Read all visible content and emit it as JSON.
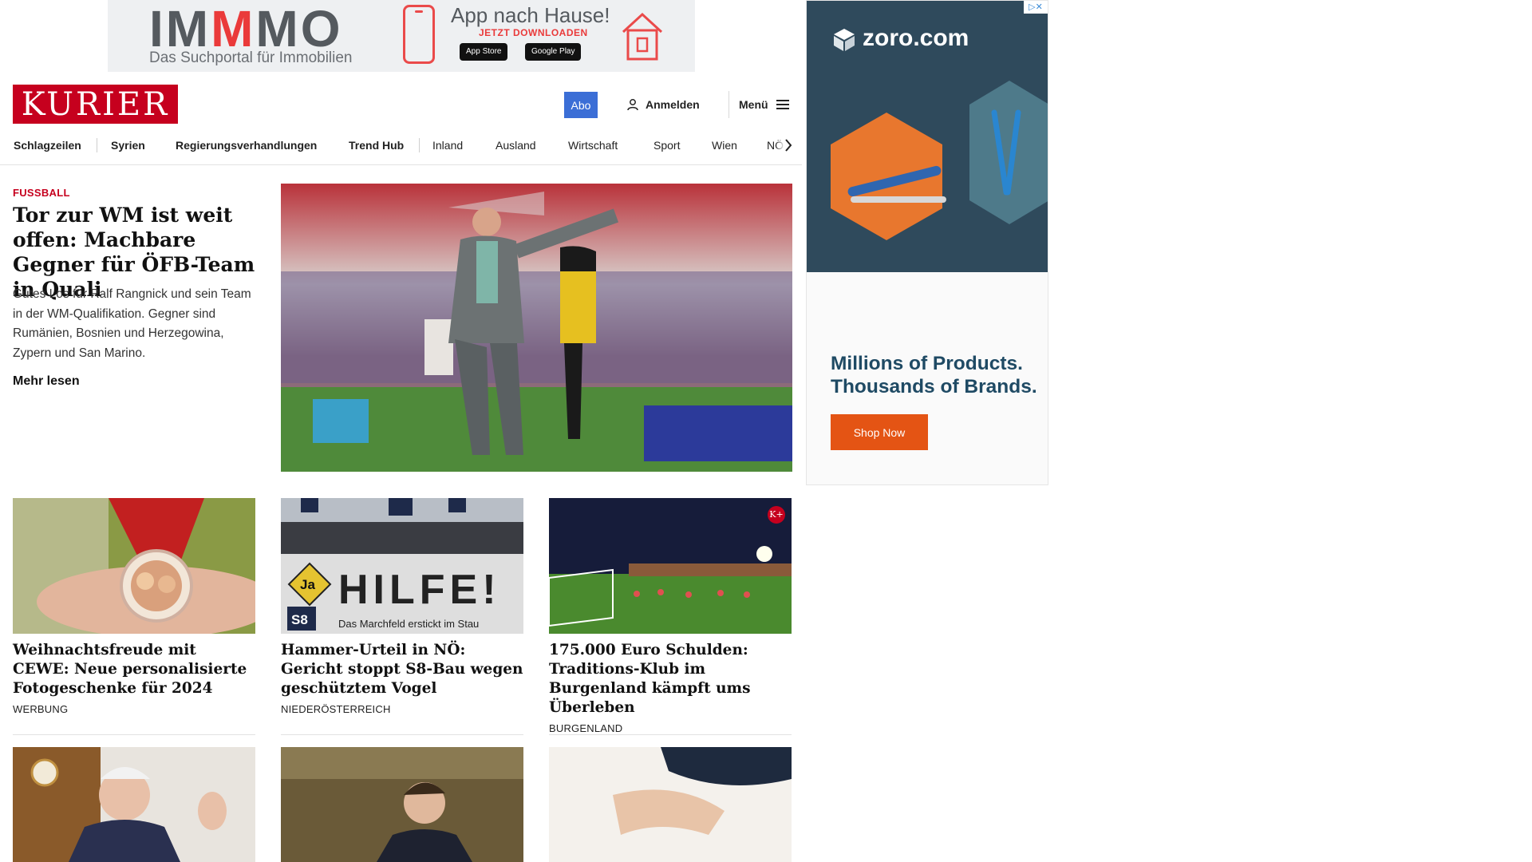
{
  "top_ad": {
    "brand_pre": "IM",
    "brand_m": "M",
    "brand_post": "MO",
    "tagline": "Das Suchportal für Immobilien",
    "title": "App nach Hause!",
    "subtitle": "JETZT DOWNLOADEN",
    "app_store": "App Store",
    "google_play": "Google Play"
  },
  "header": {
    "logo": "KURIER",
    "abo": "Abo",
    "login": "Anmelden",
    "menu": "Menü"
  },
  "nav": {
    "items": [
      "Schlagzeilen",
      "Syrien",
      "Regierungsverhandlungen",
      "Trend Hub",
      "Inland",
      "Ausland",
      "Wirtschaft",
      "Sport",
      "Wien",
      "NÖ"
    ]
  },
  "lead": {
    "category": "FUSSBALL",
    "title": "Tor zur WM ist weit offen: Machbare Gegner für ÖFB-Team in Quali",
    "teaser": "Gutes Los für Ralf Rangnick und sein Team in der WM-Qualifikation. Gegner sind Rumänien, Bosnien und Herzegowina, Zypern und San Marino.",
    "more": "Mehr lesen"
  },
  "cards": [
    {
      "title": "Weihnachtsfreude mit CEWE: Neue personalisierte Fotogeschenke für 2024",
      "category": "WERBUNG"
    },
    {
      "title": "Hammer-Urteil in NÖ: Gericht stoppt S8-Bau wegen geschütztem Vogel",
      "category": "NIEDERÖSTERREICH",
      "banner": "HILFE!",
      "banner_sub": "Das Marchfeld erstickt im Stau",
      "sign": "S8",
      "ja": "Ja"
    },
    {
      "title": "175.000 Euro Schulden: Traditions-Klub im Burgenland kämpft ums Überleben",
      "category": "BURGENLAND",
      "badge": "K+"
    }
  ],
  "side_ad": {
    "brand": "zoro.com",
    "headline": "Millions of Products. Thousands of Brands.",
    "cta": "Shop Now",
    "colors": {
      "panel": "#2f4a5c",
      "orange": "#e8772e",
      "teal": "#4e7a8a",
      "cta": "#e45414"
    }
  },
  "colors": {
    "brand_red": "#c6001e",
    "abo_blue": "#3b6ed6"
  }
}
